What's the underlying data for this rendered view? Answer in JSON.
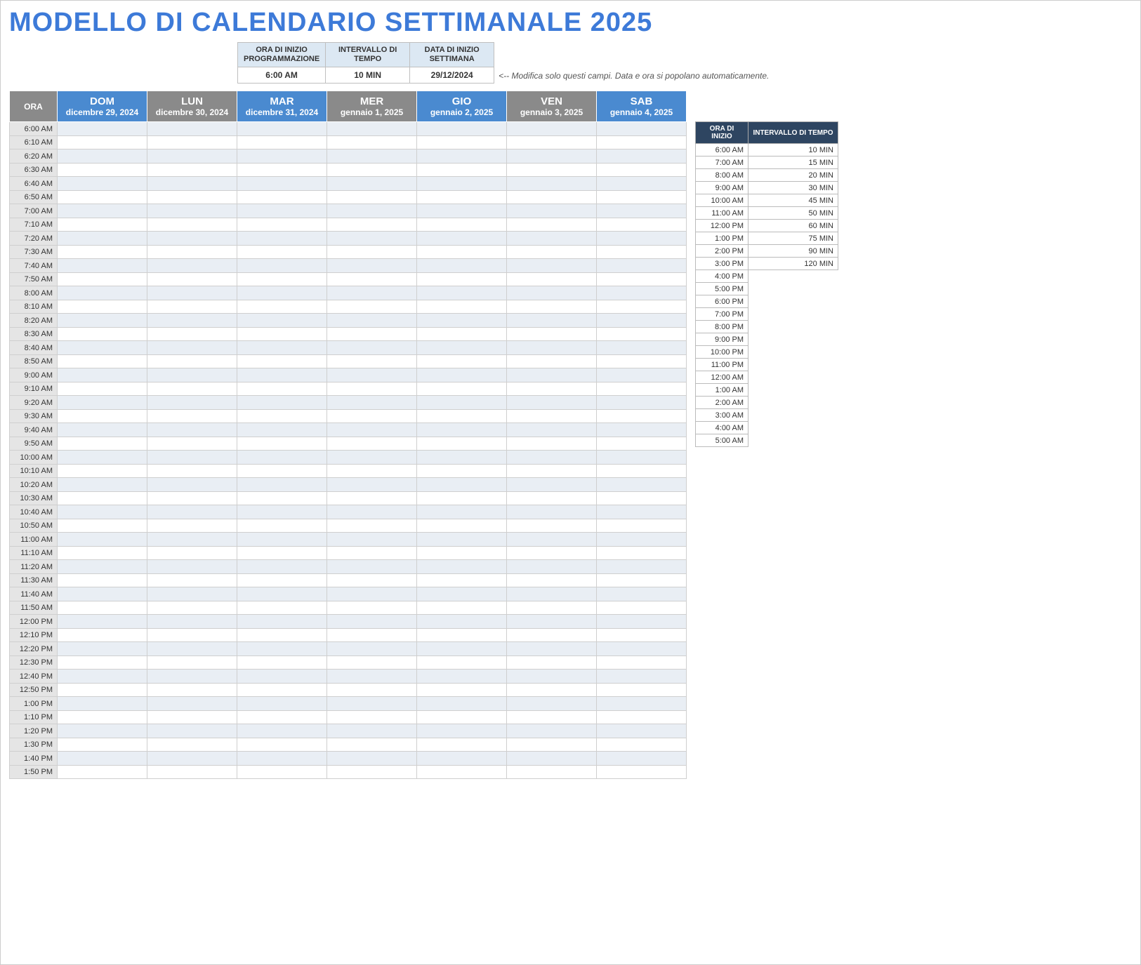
{
  "title": "MODELLO DI CALENDARIO SETTIMANALE 2025",
  "config": {
    "headers": {
      "start": "ORA DI INIZIO PROGRAMMAZIONE",
      "interval": "INTERVALLO DI TEMPO",
      "week_start": "DATA DI INIZIO SETTIMANA"
    },
    "values": {
      "start": "6:00 AM",
      "interval": "10 MIN",
      "week_start": "29/12/2024"
    },
    "note": "<-- Modifica solo questi campi. Data e ora si popolano automaticamente."
  },
  "calendar": {
    "ora_label": "ORA",
    "days": [
      {
        "name": "DOM",
        "date": "dicembre 29, 2024",
        "style": "blue"
      },
      {
        "name": "LUN",
        "date": "dicembre 30, 2024",
        "style": "gray"
      },
      {
        "name": "MAR",
        "date": "dicembre 31, 2024",
        "style": "blue"
      },
      {
        "name": "MER",
        "date": "gennaio 1, 2025",
        "style": "gray"
      },
      {
        "name": "GIO",
        "date": "gennaio 2, 2025",
        "style": "blue"
      },
      {
        "name": "VEN",
        "date": "gennaio 3, 2025",
        "style": "gray"
      },
      {
        "name": "SAB",
        "date": "gennaio 4, 2025",
        "style": "blue"
      }
    ],
    "times": [
      "6:00 AM",
      "6:10 AM",
      "6:20 AM",
      "6:30 AM",
      "6:40 AM",
      "6:50 AM",
      "7:00 AM",
      "7:10 AM",
      "7:20 AM",
      "7:30 AM",
      "7:40 AM",
      "7:50 AM",
      "8:00 AM",
      "8:10 AM",
      "8:20 AM",
      "8:30 AM",
      "8:40 AM",
      "8:50 AM",
      "9:00 AM",
      "9:10 AM",
      "9:20 AM",
      "9:30 AM",
      "9:40 AM",
      "9:50 AM",
      "10:00 AM",
      "10:10 AM",
      "10:20 AM",
      "10:30 AM",
      "10:40 AM",
      "10:50 AM",
      "11:00 AM",
      "11:10 AM",
      "11:20 AM",
      "11:30 AM",
      "11:40 AM",
      "11:50 AM",
      "12:00 PM",
      "12:10 PM",
      "12:20 PM",
      "12:30 PM",
      "12:40 PM",
      "12:50 PM",
      "1:00 PM",
      "1:10 PM",
      "1:20 PM",
      "1:30 PM",
      "1:40 PM",
      "1:50 PM"
    ]
  },
  "side": {
    "headers": {
      "start": "ORA DI INIZIO",
      "interval": "INTERVALLO DI TEMPO"
    },
    "rows": [
      {
        "start": "6:00 AM",
        "interval": "10 MIN"
      },
      {
        "start": "7:00 AM",
        "interval": "15 MIN"
      },
      {
        "start": "8:00 AM",
        "interval": "20 MIN"
      },
      {
        "start": "9:00 AM",
        "interval": "30 MIN"
      },
      {
        "start": "10:00 AM",
        "interval": "45 MIN"
      },
      {
        "start": "11:00 AM",
        "interval": "50 MIN"
      },
      {
        "start": "12:00 PM",
        "interval": "60 MIN"
      },
      {
        "start": "1:00 PM",
        "interval": "75 MIN"
      },
      {
        "start": "2:00 PM",
        "interval": "90 MIN"
      },
      {
        "start": "3:00 PM",
        "interval": "120 MIN"
      },
      {
        "start": "4:00 PM",
        "interval": ""
      },
      {
        "start": "5:00 PM",
        "interval": ""
      },
      {
        "start": "6:00 PM",
        "interval": ""
      },
      {
        "start": "7:00 PM",
        "interval": ""
      },
      {
        "start": "8:00 PM",
        "interval": ""
      },
      {
        "start": "9:00 PM",
        "interval": ""
      },
      {
        "start": "10:00 PM",
        "interval": ""
      },
      {
        "start": "11:00 PM",
        "interval": ""
      },
      {
        "start": "12:00 AM",
        "interval": ""
      },
      {
        "start": "1:00 AM",
        "interval": ""
      },
      {
        "start": "2:00 AM",
        "interval": ""
      },
      {
        "start": "3:00 AM",
        "interval": ""
      },
      {
        "start": "4:00 AM",
        "interval": ""
      },
      {
        "start": "5:00 AM",
        "interval": ""
      }
    ]
  }
}
